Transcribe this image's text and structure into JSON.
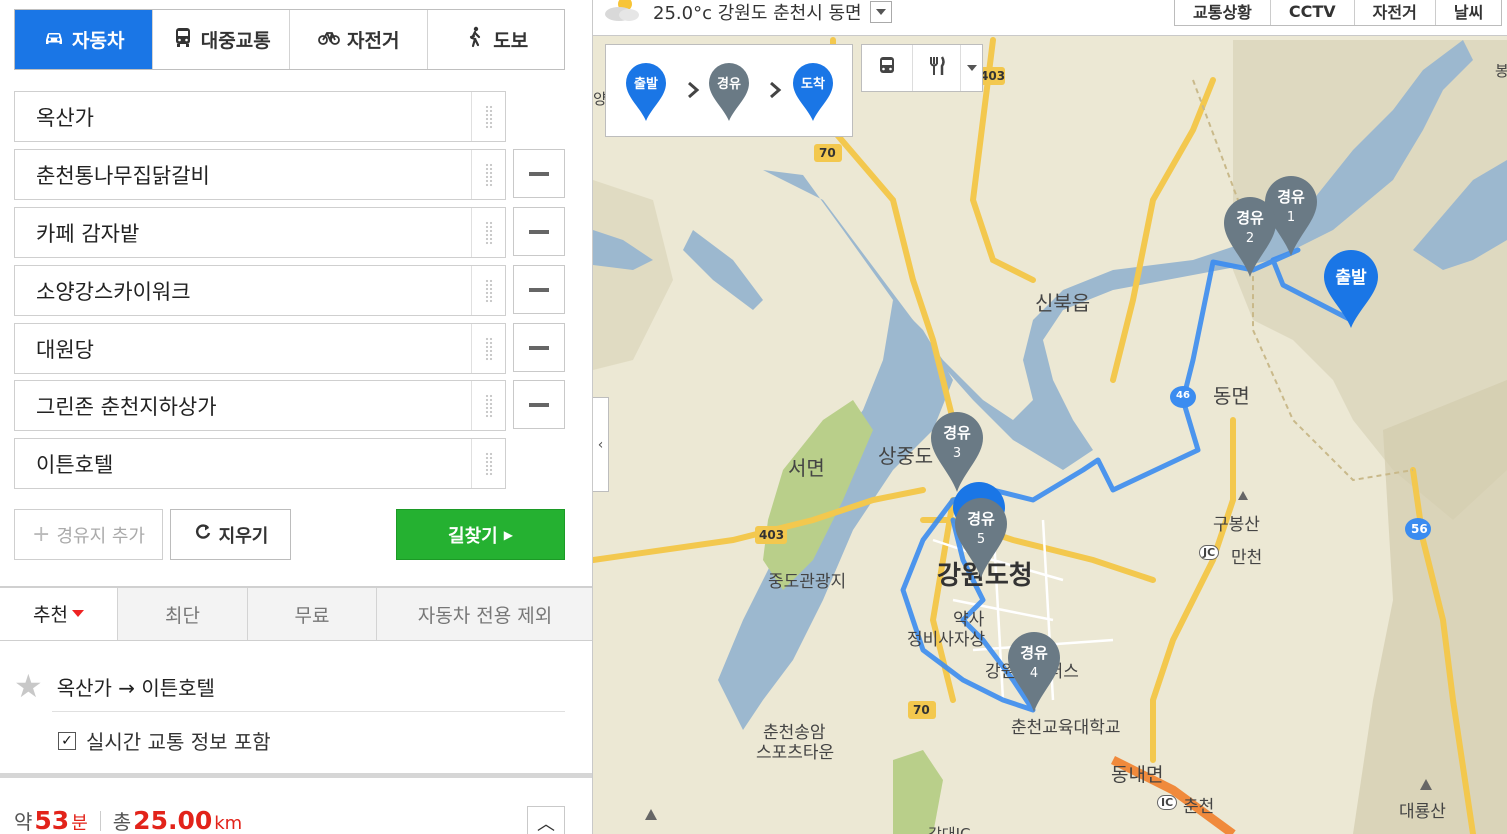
{
  "modes": [
    {
      "label": "자동차",
      "icon": "car-icon",
      "active": true
    },
    {
      "label": "대중교통",
      "icon": "bus-icon",
      "active": false
    },
    {
      "label": "자전거",
      "icon": "bicycle-icon",
      "active": false
    },
    {
      "label": "도보",
      "icon": "walk-icon",
      "active": false
    }
  ],
  "waypoints": [
    {
      "value": "옥산가",
      "removable": false
    },
    {
      "value": "춘천통나무집닭갈비",
      "removable": true
    },
    {
      "value": "카페 감자밭",
      "removable": true
    },
    {
      "value": "소양강스카이워크",
      "removable": true
    },
    {
      "value": "대원당",
      "removable": true
    },
    {
      "value": "그린존 춘천지하상가",
      "removable": true
    },
    {
      "value": "이튼호텔",
      "removable": false
    }
  ],
  "actions": {
    "add_waypoint": "경유지 추가",
    "clear": "지우기",
    "search": "길찾기"
  },
  "option_tabs": [
    {
      "label": "추천",
      "active": true
    },
    {
      "label": "최단",
      "active": false
    },
    {
      "label": "무료",
      "active": false
    },
    {
      "label": "자동차 전용 제외",
      "active": false
    }
  ],
  "route": {
    "title": "옥산가 → 이튼호텔",
    "traffic_label": "실시간 교통 정보 포함",
    "traffic_checked": true
  },
  "summary": {
    "approx_label": "약",
    "minutes": "53",
    "minutes_unit": "분",
    "total_label": "총",
    "distance": "25.00",
    "distance_unit": "km"
  },
  "map": {
    "weather_text": "25.0°c 강원도 춘천시 동면",
    "layer_buttons": [
      "교통상황",
      "CCTV",
      "자전거",
      "날씨"
    ],
    "legend": {
      "start": "출발",
      "via": "경유",
      "end": "도착"
    },
    "place_labels": [
      {
        "text": "신북읍"
      },
      {
        "text": "동면"
      },
      {
        "text": "서면"
      },
      {
        "text": "상중도"
      },
      {
        "text": "강원도청"
      },
      {
        "text": "중도관광지"
      },
      {
        "text": "구봉산"
      },
      {
        "text": "만천"
      },
      {
        "text": "약사"
      },
      {
        "text": "정비사자상"
      },
      {
        "text": "강원대캠퍼스"
      },
      {
        "text": "춘천교육대학교"
      },
      {
        "text": "춘천송암"
      },
      {
        "text": "스포츠타운"
      },
      {
        "text": "동내면"
      },
      {
        "text": "춘천"
      },
      {
        "text": "대룡산"
      },
      {
        "text": "강대IC"
      },
      {
        "text": "봉"
      },
      {
        "text": "양"
      }
    ],
    "road_shields": [
      {
        "text": "70"
      },
      {
        "text": "403"
      },
      {
        "text": "403"
      },
      {
        "text": "70"
      },
      {
        "text": "56"
      },
      {
        "text": "46"
      }
    ],
    "ic_labels": [
      {
        "text": "JC"
      },
      {
        "text": "IC"
      }
    ],
    "markers": [
      {
        "type": "start",
        "label": "출발",
        "num": ""
      },
      {
        "type": "via",
        "label": "경유",
        "num": "1"
      },
      {
        "type": "via",
        "label": "경유",
        "num": "2"
      },
      {
        "type": "via",
        "label": "경유",
        "num": "3"
      },
      {
        "type": "via",
        "label": "경유",
        "num": "4"
      },
      {
        "type": "via",
        "label": "경유",
        "num": "5"
      }
    ],
    "colors": {
      "route": "#3b8cf0",
      "start_marker": "#1a76e6",
      "via_marker": "#6a7a85",
      "water": "#9cb8cf",
      "land": "#ece8d4",
      "road": "#f3c84e"
    }
  }
}
